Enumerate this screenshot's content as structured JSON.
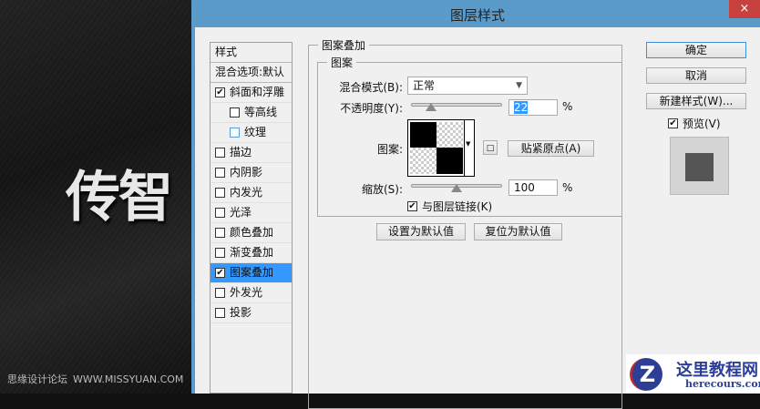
{
  "background": {
    "headline": "传智",
    "watermark_cn": "思缘设计论坛",
    "watermark_url": "WWW.MISSYUAN.COM"
  },
  "dialog": {
    "title": "图层样式",
    "close": "×"
  },
  "styles_panel": {
    "header": "样式",
    "blend_options": "混合选项:默认",
    "items": [
      {
        "label": "斜面和浮雕",
        "checked": true,
        "indent": false
      },
      {
        "label": "等高线",
        "checked": false,
        "indent": true
      },
      {
        "label": "纹理",
        "checked": false,
        "indent": true
      },
      {
        "label": "描边",
        "checked": false
      },
      {
        "label": "内阴影",
        "checked": false
      },
      {
        "label": "内发光",
        "checked": false
      },
      {
        "label": "光泽",
        "checked": false
      },
      {
        "label": "颜色叠加",
        "checked": false
      },
      {
        "label": "渐变叠加",
        "checked": false
      },
      {
        "label": "图案叠加",
        "checked": true,
        "selected": true
      },
      {
        "label": "外发光",
        "checked": false
      },
      {
        "label": "投影",
        "checked": false
      }
    ]
  },
  "pattern_overlay": {
    "group_title": "图案叠加",
    "subgroup_title": "图案",
    "blend_mode_label": "混合模式(B):",
    "blend_mode_value": "正常",
    "opacity_label": "不透明度(Y):",
    "opacity_value": "22",
    "opacity_unit": "%",
    "opacity_percent": 22,
    "pattern_label": "图案:",
    "snap_origin": "贴紧原点(A)",
    "scale_label": "缩放(S):",
    "scale_value": "100",
    "scale_unit": "%",
    "scale_percent": 100,
    "link_label": "与图层链接(K)",
    "link_checked": true,
    "make_default": "设置为默认值",
    "reset_default": "复位为默认值"
  },
  "buttons": {
    "ok": "确定",
    "cancel": "取消",
    "new_style": "新建样式(W)...",
    "preview": "预览(V)",
    "preview_checked": true
  },
  "logo": {
    "name": "这里教程网",
    "url": "herecours.com"
  },
  "colors": {
    "titlebar": "#5b9bc9",
    "selection": "#3399ff",
    "close": "#c7413f"
  }
}
